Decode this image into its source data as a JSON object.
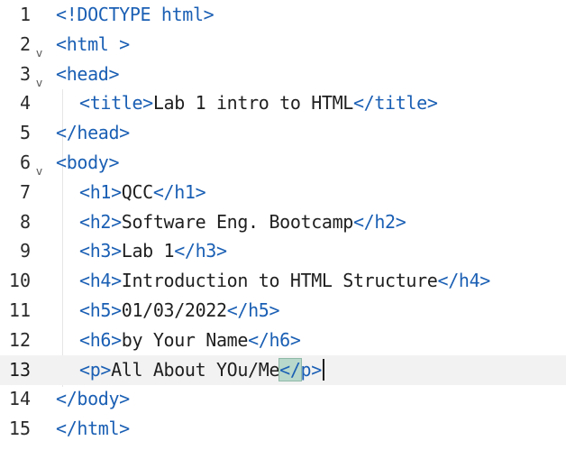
{
  "editor": {
    "lines": [
      {
        "number": "1",
        "parts": [
          {
            "text": "<!DOCTYPE html>",
            "kind": "tag"
          }
        ]
      },
      {
        "number": "2",
        "folded": true,
        "parts": [
          {
            "text": "<html >",
            "kind": "tag"
          }
        ]
      },
      {
        "number": "3",
        "folded": true,
        "parts": [
          {
            "text": "<head>",
            "kind": "tag"
          }
        ]
      },
      {
        "number": "4",
        "indent": 1,
        "parts": [
          {
            "text": "<title>",
            "kind": "tag"
          },
          {
            "text": "Lab 1 intro to HTML",
            "kind": "text"
          },
          {
            "text": "</title>",
            "kind": "tag"
          }
        ]
      },
      {
        "number": "5",
        "parts": [
          {
            "text": "</head>",
            "kind": "tag"
          }
        ]
      },
      {
        "number": "6",
        "folded": true,
        "parts": [
          {
            "text": "<body>",
            "kind": "tag"
          }
        ]
      },
      {
        "number": "7",
        "indent": 1,
        "parts": [
          {
            "text": "<h1>",
            "kind": "tag"
          },
          {
            "text": "QCC",
            "kind": "text"
          },
          {
            "text": "</h1>",
            "kind": "tag"
          }
        ]
      },
      {
        "number": "8",
        "indent": 1,
        "parts": [
          {
            "text": "<h2>",
            "kind": "tag"
          },
          {
            "text": "Software Eng. Bootcamp",
            "kind": "text"
          },
          {
            "text": "</h2>",
            "kind": "tag"
          }
        ]
      },
      {
        "number": "9",
        "indent": 1,
        "parts": [
          {
            "text": "<h3>",
            "kind": "tag"
          },
          {
            "text": "Lab 1",
            "kind": "text"
          },
          {
            "text": "</h3>",
            "kind": "tag"
          }
        ]
      },
      {
        "number": "10",
        "indent": 1,
        "parts": [
          {
            "text": "<h4>",
            "kind": "tag"
          },
          {
            "text": "Introduction to HTML Structure",
            "kind": "text"
          },
          {
            "text": "</h4>",
            "kind": "tag"
          }
        ]
      },
      {
        "number": "11",
        "indent": 1,
        "parts": [
          {
            "text": "<h5>",
            "kind": "tag"
          },
          {
            "text": "01/03/2022",
            "kind": "text"
          },
          {
            "text": "</h5>",
            "kind": "tag"
          }
        ]
      },
      {
        "number": "12",
        "indent": 1,
        "parts": [
          {
            "text": "<h6>",
            "kind": "tag"
          },
          {
            "text": "by Your Name",
            "kind": "text"
          },
          {
            "text": "</h6>",
            "kind": "tag"
          }
        ]
      },
      {
        "number": "13",
        "indent": 1,
        "active": true,
        "parts": [
          {
            "text": "<p>",
            "kind": "tag"
          },
          {
            "text": "All About YOu/Me",
            "kind": "text"
          },
          {
            "text": "</p>",
            "kind": "tag",
            "bracket_match": true,
            "cursor_after": true
          }
        ]
      },
      {
        "number": "14",
        "parts": [
          {
            "text": "</body>",
            "kind": "tag"
          }
        ]
      },
      {
        "number": "15",
        "parts": [
          {
            "text": "</html>",
            "kind": "tag"
          }
        ]
      }
    ]
  },
  "icons": {
    "fold": "chevron-down-icon"
  },
  "colors": {
    "tag": "#1a5fb4",
    "punctuation": "#5e6a73",
    "text": "#1f1f1f",
    "active_line": "#f2f2f2",
    "bracket_match": "#b8d8cc"
  }
}
